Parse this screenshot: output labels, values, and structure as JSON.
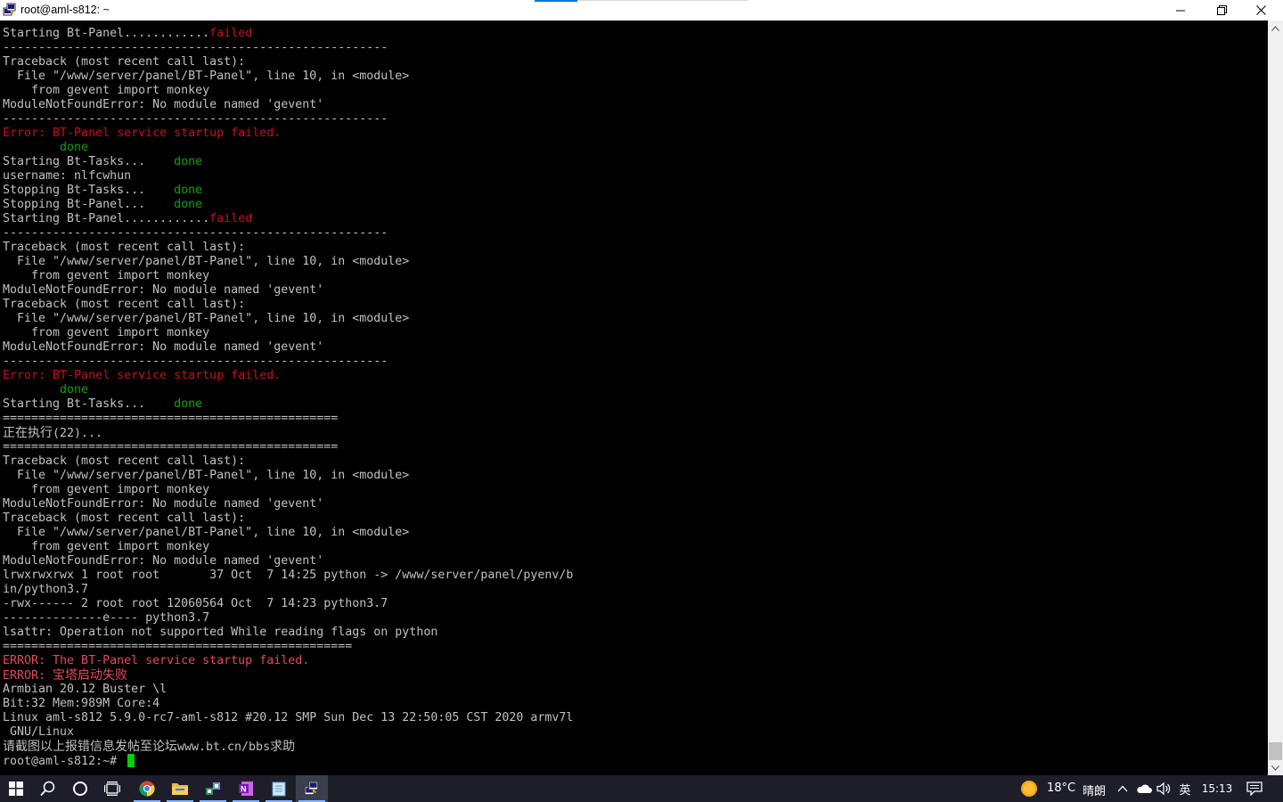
{
  "window": {
    "title": "root@aml-s812: ~"
  },
  "colors": {
    "terminal_bg": "#000000",
    "text": "#c0c0c0",
    "red": "#c50f1f",
    "bright_red": "#e74856",
    "green": "#13a10e",
    "cursor": "#00d000",
    "taskbar": "#1e1e2a"
  },
  "terminal": {
    "lines": [
      [
        {
          "t": "Starting Bt-Panel............"
        },
        {
          "t": "failed",
          "c": "red"
        }
      ],
      [
        {
          "t": "------------------------------------------------------"
        }
      ],
      [
        {
          "t": "Traceback (most recent call last):"
        }
      ],
      [
        {
          "t": "  File \"/www/server/panel/BT-Panel\", line 10, in <module>"
        }
      ],
      [
        {
          "t": "    from gevent import monkey"
        }
      ],
      [
        {
          "t": "ModuleNotFoundError: No module named 'gevent'"
        }
      ],
      [
        {
          "t": "------------------------------------------------------"
        }
      ],
      [
        {
          "t": "Error: BT-Panel service startup failed.",
          "c": "red"
        }
      ],
      [
        {
          "t": "        "
        },
        {
          "t": "done",
          "c": "green"
        }
      ],
      [
        {
          "t": "Starting Bt-Tasks...    "
        },
        {
          "t": "done",
          "c": "green"
        }
      ],
      [
        {
          "t": "username: nlfcwhun"
        }
      ],
      [
        {
          "t": "Stopping Bt-Tasks...    "
        },
        {
          "t": "done",
          "c": "green"
        }
      ],
      [
        {
          "t": "Stopping Bt-Panel...    "
        },
        {
          "t": "done",
          "c": "green"
        }
      ],
      [
        {
          "t": "Starting Bt-Panel............"
        },
        {
          "t": "failed",
          "c": "red"
        }
      ],
      [
        {
          "t": "------------------------------------------------------"
        }
      ],
      [
        {
          "t": "Traceback (most recent call last):"
        }
      ],
      [
        {
          "t": "  File \"/www/server/panel/BT-Panel\", line 10, in <module>"
        }
      ],
      [
        {
          "t": "    from gevent import monkey"
        }
      ],
      [
        {
          "t": "ModuleNotFoundError: No module named 'gevent'"
        }
      ],
      [
        {
          "t": "Traceback (most recent call last):"
        }
      ],
      [
        {
          "t": "  File \"/www/server/panel/BT-Panel\", line 10, in <module>"
        }
      ],
      [
        {
          "t": "    from gevent import monkey"
        }
      ],
      [
        {
          "t": "ModuleNotFoundError: No module named 'gevent'"
        }
      ],
      [
        {
          "t": "------------------------------------------------------"
        }
      ],
      [
        {
          "t": "Error: BT-Panel service startup failed.",
          "c": "red"
        }
      ],
      [
        {
          "t": "        "
        },
        {
          "t": "done",
          "c": "green"
        }
      ],
      [
        {
          "t": "Starting Bt-Tasks...    "
        },
        {
          "t": "done",
          "c": "green"
        }
      ],
      [
        {
          "t": "==============================================="
        }
      ],
      [
        {
          "t": "正在执行",
          "c": "cjk"
        },
        {
          "t": "(22)..."
        }
      ],
      [
        {
          "t": "==============================================="
        }
      ],
      [
        {
          "t": "Traceback (most recent call last):"
        }
      ],
      [
        {
          "t": "  File \"/www/server/panel/BT-Panel\", line 10, in <module>"
        }
      ],
      [
        {
          "t": "    from gevent import monkey"
        }
      ],
      [
        {
          "t": "ModuleNotFoundError: No module named 'gevent'"
        }
      ],
      [
        {
          "t": "Traceback (most recent call last):"
        }
      ],
      [
        {
          "t": "  File \"/www/server/panel/BT-Panel\", line 10, in <module>"
        }
      ],
      [
        {
          "t": "    from gevent import monkey"
        }
      ],
      [
        {
          "t": "ModuleNotFoundError: No module named 'gevent'"
        }
      ],
      [
        {
          "t": "lrwxrwxrwx 1 root root       37 Oct  7 14:25 python -> /www/server/panel/pyenv/b"
        }
      ],
      [
        {
          "t": "in/python3.7"
        }
      ],
      [
        {
          "t": "-rwx------ 2 root root 12060564 Oct  7 14:23 python3.7"
        }
      ],
      [
        {
          "t": "--------------e---- python3.7"
        }
      ],
      [
        {
          "t": "lsattr: Operation not supported While reading flags on python"
        }
      ],
      [
        {
          "t": "================================================="
        }
      ],
      [
        {
          "t": "ERROR: The BT-Panel service startup failed.",
          "c": "bred"
        }
      ],
      [
        {
          "t": "ERROR: ",
          "c": "bred"
        },
        {
          "t": "宝塔启动失败",
          "c": "bred cjk"
        }
      ],
      [
        {
          "t": "Armbian 20.12 Buster \\l"
        }
      ],
      [
        {
          "t": "Bit:32 Mem:989M Core:4"
        }
      ],
      [
        {
          "t": "Linux aml-s812 5.9.0-rc7-aml-s812 #20.12 SMP Sun Dec 13 22:50:05 CST 2020 armv7l"
        }
      ],
      [
        {
          "t": " GNU/Linux"
        }
      ],
      [
        {
          "t": "请截图以上报错信息发帖至论坛",
          "c": "cjk"
        },
        {
          "t": "www.bt.cn/bbs"
        },
        {
          "t": "求助",
          "c": "cjk"
        }
      ],
      [
        {
          "t": "root@aml-s812:~# "
        }
      ]
    ]
  },
  "taskbar": {
    "apps": [
      {
        "name": "start-button",
        "icon": "windows-logo-icon"
      },
      {
        "name": "search-button",
        "icon": "search-icon"
      },
      {
        "name": "cortana-button",
        "icon": "cortana-circle-icon"
      },
      {
        "name": "task-view-button",
        "icon": "task-view-icon"
      },
      {
        "name": "chrome-app",
        "icon": "chrome-icon"
      },
      {
        "name": "file-explorer-app",
        "icon": "folder-icon"
      },
      {
        "name": "network-tool-app",
        "icon": "network-icon"
      },
      {
        "name": "onenote-app",
        "icon": "onenote-icon"
      },
      {
        "name": "notepad-app",
        "icon": "notepad-icon"
      },
      {
        "name": "putty-app",
        "icon": "putty-icon"
      }
    ],
    "weather": {
      "temp": "18°C",
      "condition": "晴朗"
    },
    "ime": "英",
    "clock": "15:13"
  }
}
